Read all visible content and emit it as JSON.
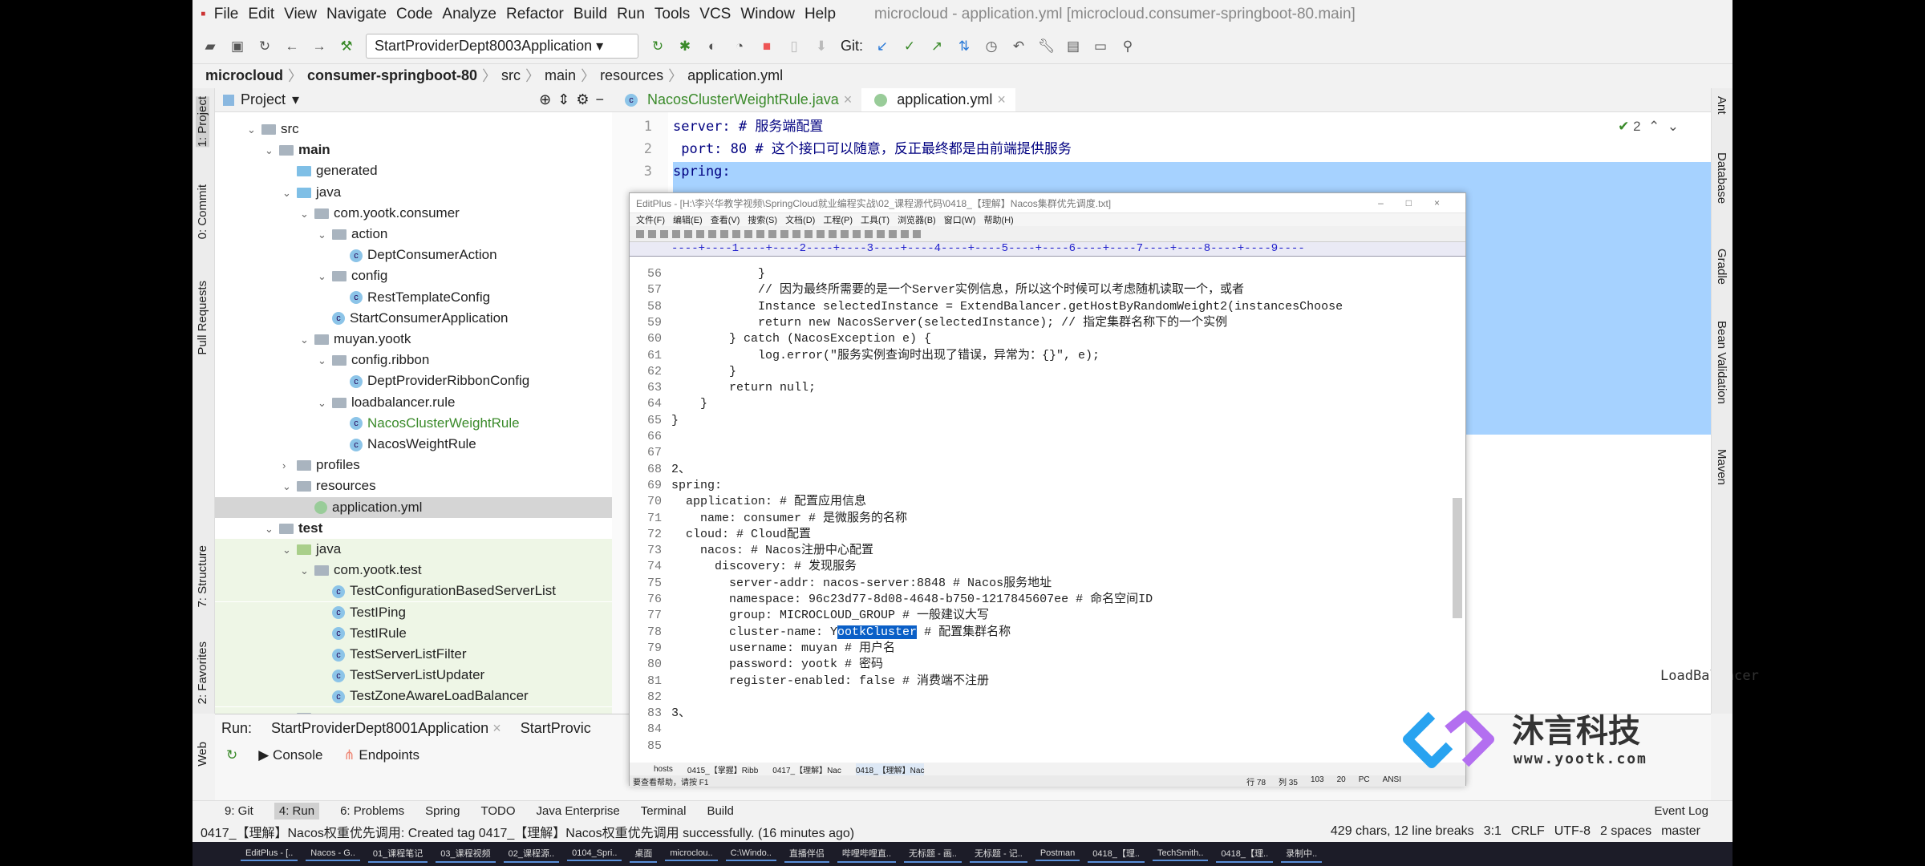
{
  "menu": {
    "items": [
      "File",
      "Edit",
      "View",
      "Navigate",
      "Code",
      "Analyze",
      "Refactor",
      "Build",
      "Run",
      "Tools",
      "VCS",
      "Window",
      "Help"
    ],
    "title": "microcloud - application.yml [microcloud.consumer-springboot-80.main]"
  },
  "toolbar": {
    "run_config": "StartProviderDept8003Application",
    "git_label": "Git:"
  },
  "breadcrumb": [
    "microcloud",
    "consumer-springboot-80",
    "src",
    "main",
    "resources",
    "application.yml"
  ],
  "left_strip": [
    "1: Project",
    "0: Commit",
    "Pull Requests",
    "7: Structure",
    "2: Favorites",
    "Web"
  ],
  "right_strip": [
    "Ant",
    "Database",
    "Gradle",
    "Bean Validation",
    "Maven"
  ],
  "project": {
    "title": "Project",
    "tree": [
      {
        "label": "src",
        "depth": 0,
        "kind": "folder",
        "arrow": "v"
      },
      {
        "label": "main",
        "depth": 1,
        "kind": "folder",
        "arrow": "v",
        "bold": true
      },
      {
        "label": "generated",
        "depth": 2,
        "kind": "folder-blue",
        "arrow": ""
      },
      {
        "label": "java",
        "depth": 2,
        "kind": "folder-blue",
        "arrow": "v"
      },
      {
        "label": "com.yootk.consumer",
        "depth": 3,
        "kind": "folder",
        "arrow": "v"
      },
      {
        "label": "action",
        "depth": 4,
        "kind": "folder",
        "arrow": "v"
      },
      {
        "label": "DeptConsumerAction",
        "depth": 5,
        "kind": "class",
        "arrow": ""
      },
      {
        "label": "config",
        "depth": 4,
        "kind": "folder",
        "arrow": "v"
      },
      {
        "label": "RestTemplateConfig",
        "depth": 5,
        "kind": "class",
        "arrow": ""
      },
      {
        "label": "StartConsumerApplication",
        "depth": 4,
        "kind": "class",
        "arrow": ""
      },
      {
        "label": "muyan.yootk",
        "depth": 3,
        "kind": "folder",
        "arrow": "v"
      },
      {
        "label": "config.ribbon",
        "depth": 4,
        "kind": "folder",
        "arrow": "v"
      },
      {
        "label": "DeptProviderRibbonConfig",
        "depth": 5,
        "kind": "class",
        "arrow": ""
      },
      {
        "label": "loadbalancer.rule",
        "depth": 4,
        "kind": "folder",
        "arrow": "v"
      },
      {
        "label": "NacosClusterWeightRule",
        "depth": 5,
        "kind": "class",
        "arrow": "",
        "modified": true
      },
      {
        "label": "NacosWeightRule",
        "depth": 5,
        "kind": "class",
        "arrow": ""
      },
      {
        "label": "profiles",
        "depth": 2,
        "kind": "folder",
        "arrow": ">"
      },
      {
        "label": "resources",
        "depth": 2,
        "kind": "folder",
        "arrow": "v"
      },
      {
        "label": "application.yml",
        "depth": 3,
        "kind": "yml",
        "arrow": "",
        "selected": true
      },
      {
        "label": "test",
        "depth": 1,
        "kind": "folder",
        "arrow": "v",
        "bold": true
      },
      {
        "label": "java",
        "depth": 2,
        "kind": "folder-green",
        "arrow": "v",
        "test": true
      },
      {
        "label": "com.yootk.test",
        "depth": 3,
        "kind": "folder",
        "arrow": "v",
        "test": true
      },
      {
        "label": "TestConfigurationBasedServerList",
        "depth": 4,
        "kind": "class",
        "arrow": "",
        "test": true
      },
      {
        "label": "TestIPing",
        "depth": 4,
        "kind": "class",
        "arrow": "",
        "test": true
      },
      {
        "label": "TestIRule",
        "depth": 4,
        "kind": "class",
        "arrow": "",
        "test": true
      },
      {
        "label": "TestServerListFilter",
        "depth": 4,
        "kind": "class",
        "arrow": "",
        "test": true
      },
      {
        "label": "TestServerListUpdater",
        "depth": 4,
        "kind": "class",
        "arrow": "",
        "test": true
      },
      {
        "label": "TestZoneAwareLoadBalancer",
        "depth": 4,
        "kind": "class",
        "arrow": "",
        "test": true
      },
      {
        "label": "resources",
        "depth": 2,
        "kind": "folder",
        "arrow": "",
        "test": true
      }
    ]
  },
  "editor": {
    "tabs": [
      {
        "label": "NacosClusterWeightRule.java",
        "active": false
      },
      {
        "label": "application.yml",
        "active": true
      }
    ],
    "inspections": "2",
    "lines": [
      {
        "n": "1",
        "text": "server: # 服务端配置"
      },
      {
        "n": "2",
        "text": " port: 80 # 这个接口可以随意，反正最终都是由前端提供服务"
      },
      {
        "n": "3",
        "text": "spring:"
      }
    ],
    "partial_text": "LoadBalancer"
  },
  "editplus": {
    "title": "EditPlus - [H:\\李兴华教学视频\\SpringCloud就业编程实战\\02_课程源代码\\0418_【理解】Nacos集群优先调度.txt]",
    "menu": [
      "文件(F)",
      "编辑(E)",
      "查看(V)",
      "搜索(S)",
      "文档(D)",
      "工程(P)",
      "工具(T)",
      "浏览器(B)",
      "窗口(W)",
      "帮助(H)"
    ],
    "ruler": "----+----1----+----2----+----3----+----4----+----5----+----6----+----7----+----8----+----9----",
    "lines": [
      {
        "n": "56",
        "text": "            }"
      },
      {
        "n": "57",
        "text": "            // 因为最终所需要的是一个Server实例信息，所以这个时候可以考虑随机读取一个，或者"
      },
      {
        "n": "58",
        "text": "            Instance selectedInstance = ExtendBalancer.getHostByRandomWeight2(instancesChoose"
      },
      {
        "n": "59",
        "text": "            return new NacosServer(selectedInstance); // 指定集群名称下的一个实例"
      },
      {
        "n": "60",
        "text": "        } catch (NacosException e) {"
      },
      {
        "n": "61",
        "text": "            log.error(\"服务实例查询时出现了错误，异常为：{}\", e);"
      },
      {
        "n": "62",
        "text": "        }"
      },
      {
        "n": "63",
        "text": "        return null;"
      },
      {
        "n": "64",
        "text": "    }"
      },
      {
        "n": "65",
        "text": "}"
      },
      {
        "n": "66",
        "text": ""
      },
      {
        "n": "67",
        "text": ""
      },
      {
        "n": "68",
        "text": "2、"
      },
      {
        "n": "69",
        "text": "spring:"
      },
      {
        "n": "70",
        "text": "  application: # 配置应用信息"
      },
      {
        "n": "71",
        "text": "    name: consumer # 是微服务的名称"
      },
      {
        "n": "72",
        "text": "  cloud: # Cloud配置"
      },
      {
        "n": "73",
        "text": "    nacos: # Nacos注册中心配置"
      },
      {
        "n": "74",
        "text": "      discovery: # 发现服务"
      },
      {
        "n": "75",
        "text": "        server-addr: nacos-server:8848 # Nacos服务地址"
      },
      {
        "n": "76",
        "text": "        namespace: 96c23d77-8d08-4648-b750-1217845607ee # 命名空间ID"
      },
      {
        "n": "77",
        "text": "        group: MICROCLOUD_GROUP # 一般建议大写"
      },
      {
        "n": "78",
        "text": "        cluster-name: Y",
        "sel": "ootkCluster",
        "after": " # 配置集群名称"
      },
      {
        "n": "79",
        "text": "        username: muyan # 用户名"
      },
      {
        "n": "80",
        "text": "        password: yootk # 密码"
      },
      {
        "n": "81",
        "text": "        register-enabled: false # 消费端不注册"
      },
      {
        "n": "82",
        "text": ""
      },
      {
        "n": "83",
        "text": "3、"
      },
      {
        "n": "84",
        "text": ""
      },
      {
        "n": "85",
        "text": ""
      }
    ],
    "file_tabs": [
      "hosts",
      "0415_【掌握】Ribb",
      "0417_【理解】Nac",
      "0418_【理解】Nac"
    ],
    "status_left": "要查看帮助，请按 F1",
    "status_right": [
      "行 78",
      "列 35",
      "103",
      "20",
      "PC",
      "ANSI"
    ]
  },
  "run": {
    "label": "Run:",
    "configs": [
      "StartProviderDept8001Application",
      "StartProvic"
    ],
    "tabs": [
      "Console",
      "Endpoints"
    ]
  },
  "tool_windows": [
    "9: Git",
    "4: Run",
    "6: Problems",
    "Spring",
    "TODO",
    "Java Enterprise",
    "Terminal",
    "Build"
  ],
  "event_log": "Event Log",
  "status": {
    "message": "0417_【理解】Nacos权重优先调用: Created tag 0417_【理解】Nacos权重优先调用 successfully. (16 minutes ago)",
    "right": [
      "429 chars, 12 line breaks",
      "3:1",
      "CRLF",
      "UTF-8",
      "2 spaces",
      "master"
    ]
  },
  "taskbar": [
    "EditPlus - [..",
    "Nacos - G..",
    "01_课程笔记",
    "03_课程视频",
    "02_课程源..",
    "0104_Spri..",
    "桌面",
    "microclou..",
    "C:\\Windo..",
    "直播伴侣",
    "哔哩哔哩直..",
    "无标题 - 画..",
    "无标题 - 记..",
    "Postman",
    "0418_【理..",
    "TechSmith..",
    "0418_【理..",
    "录制中.."
  ],
  "watermark": {
    "brand": "沐言科技",
    "url": "www.yootk.com"
  },
  "colors": {
    "selection": "#a6d2ff",
    "editplus_highlight": "#0a5fc7",
    "modified_file": "#3a8a2a",
    "keyword": "#000080"
  }
}
